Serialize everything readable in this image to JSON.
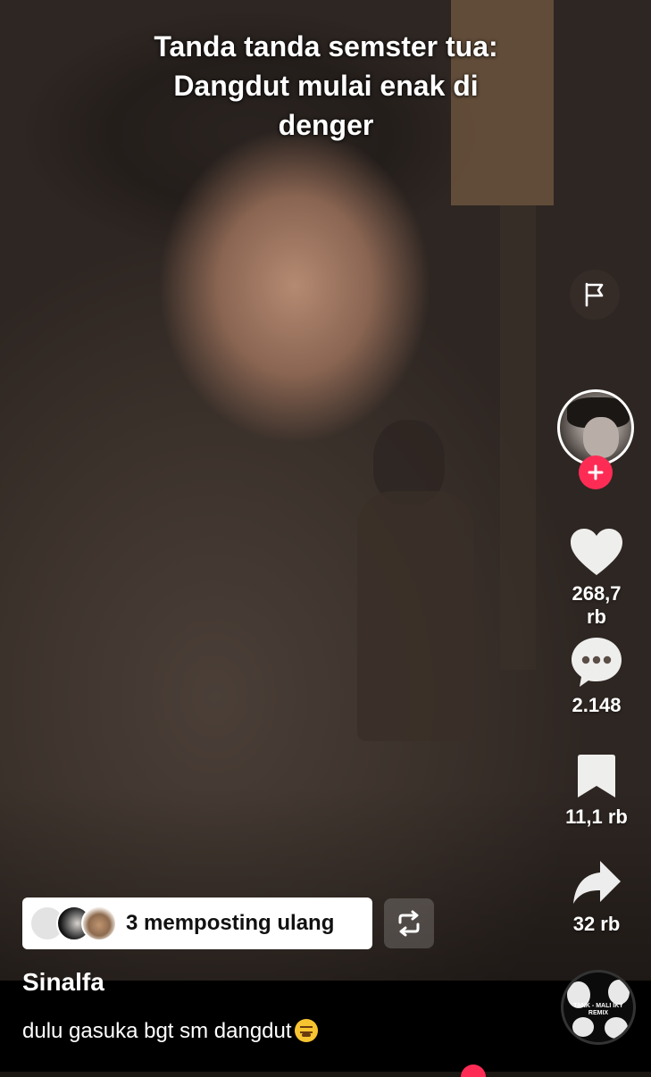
{
  "overlay": {
    "caption_line1": "Tanda tanda semster tua:",
    "caption_line2": "Dangdut mulai enak di",
    "caption_line3": "denger"
  },
  "sidebar": {
    "report_icon": "flag-icon",
    "avatar_icon": "avatar",
    "follow_icon": "plus-icon",
    "like": {
      "icon": "heart-icon",
      "count": "268,7 rb"
    },
    "comment": {
      "icon": "speech-bubble-icon",
      "count": "2.148"
    },
    "bookmark": {
      "icon": "bookmark-icon",
      "count": "11,1 rb"
    },
    "share": {
      "icon": "share-arrow-icon",
      "count": "32 rb"
    }
  },
  "repost": {
    "label": "3 memposting ulang",
    "button_icon": "repost-icon"
  },
  "post": {
    "username": "Sinalfa",
    "description": "dulu gasuka bgt sm dangdut",
    "emoji": "tired-face-emoji"
  },
  "music": {
    "disc_text": "TANK - MALI IKY REMIX"
  },
  "colors": {
    "accent": "#fe2c55",
    "bottom_bar": "#000000"
  }
}
